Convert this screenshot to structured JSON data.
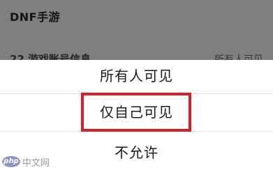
{
  "background": {
    "title": "DNF手游",
    "row_left": "22  游戏账号信息",
    "row_right": "所有人可见"
  },
  "sheet": {
    "options": [
      {
        "label": "所有人可见"
      },
      {
        "label": "仅自己可见",
        "highlighted": true
      },
      {
        "label": "不允许"
      }
    ]
  },
  "watermark": {
    "logo": "php",
    "text": "中文网"
  },
  "colors": {
    "highlight_border": "#d61f26",
    "overlay": "#7f7f7f"
  }
}
